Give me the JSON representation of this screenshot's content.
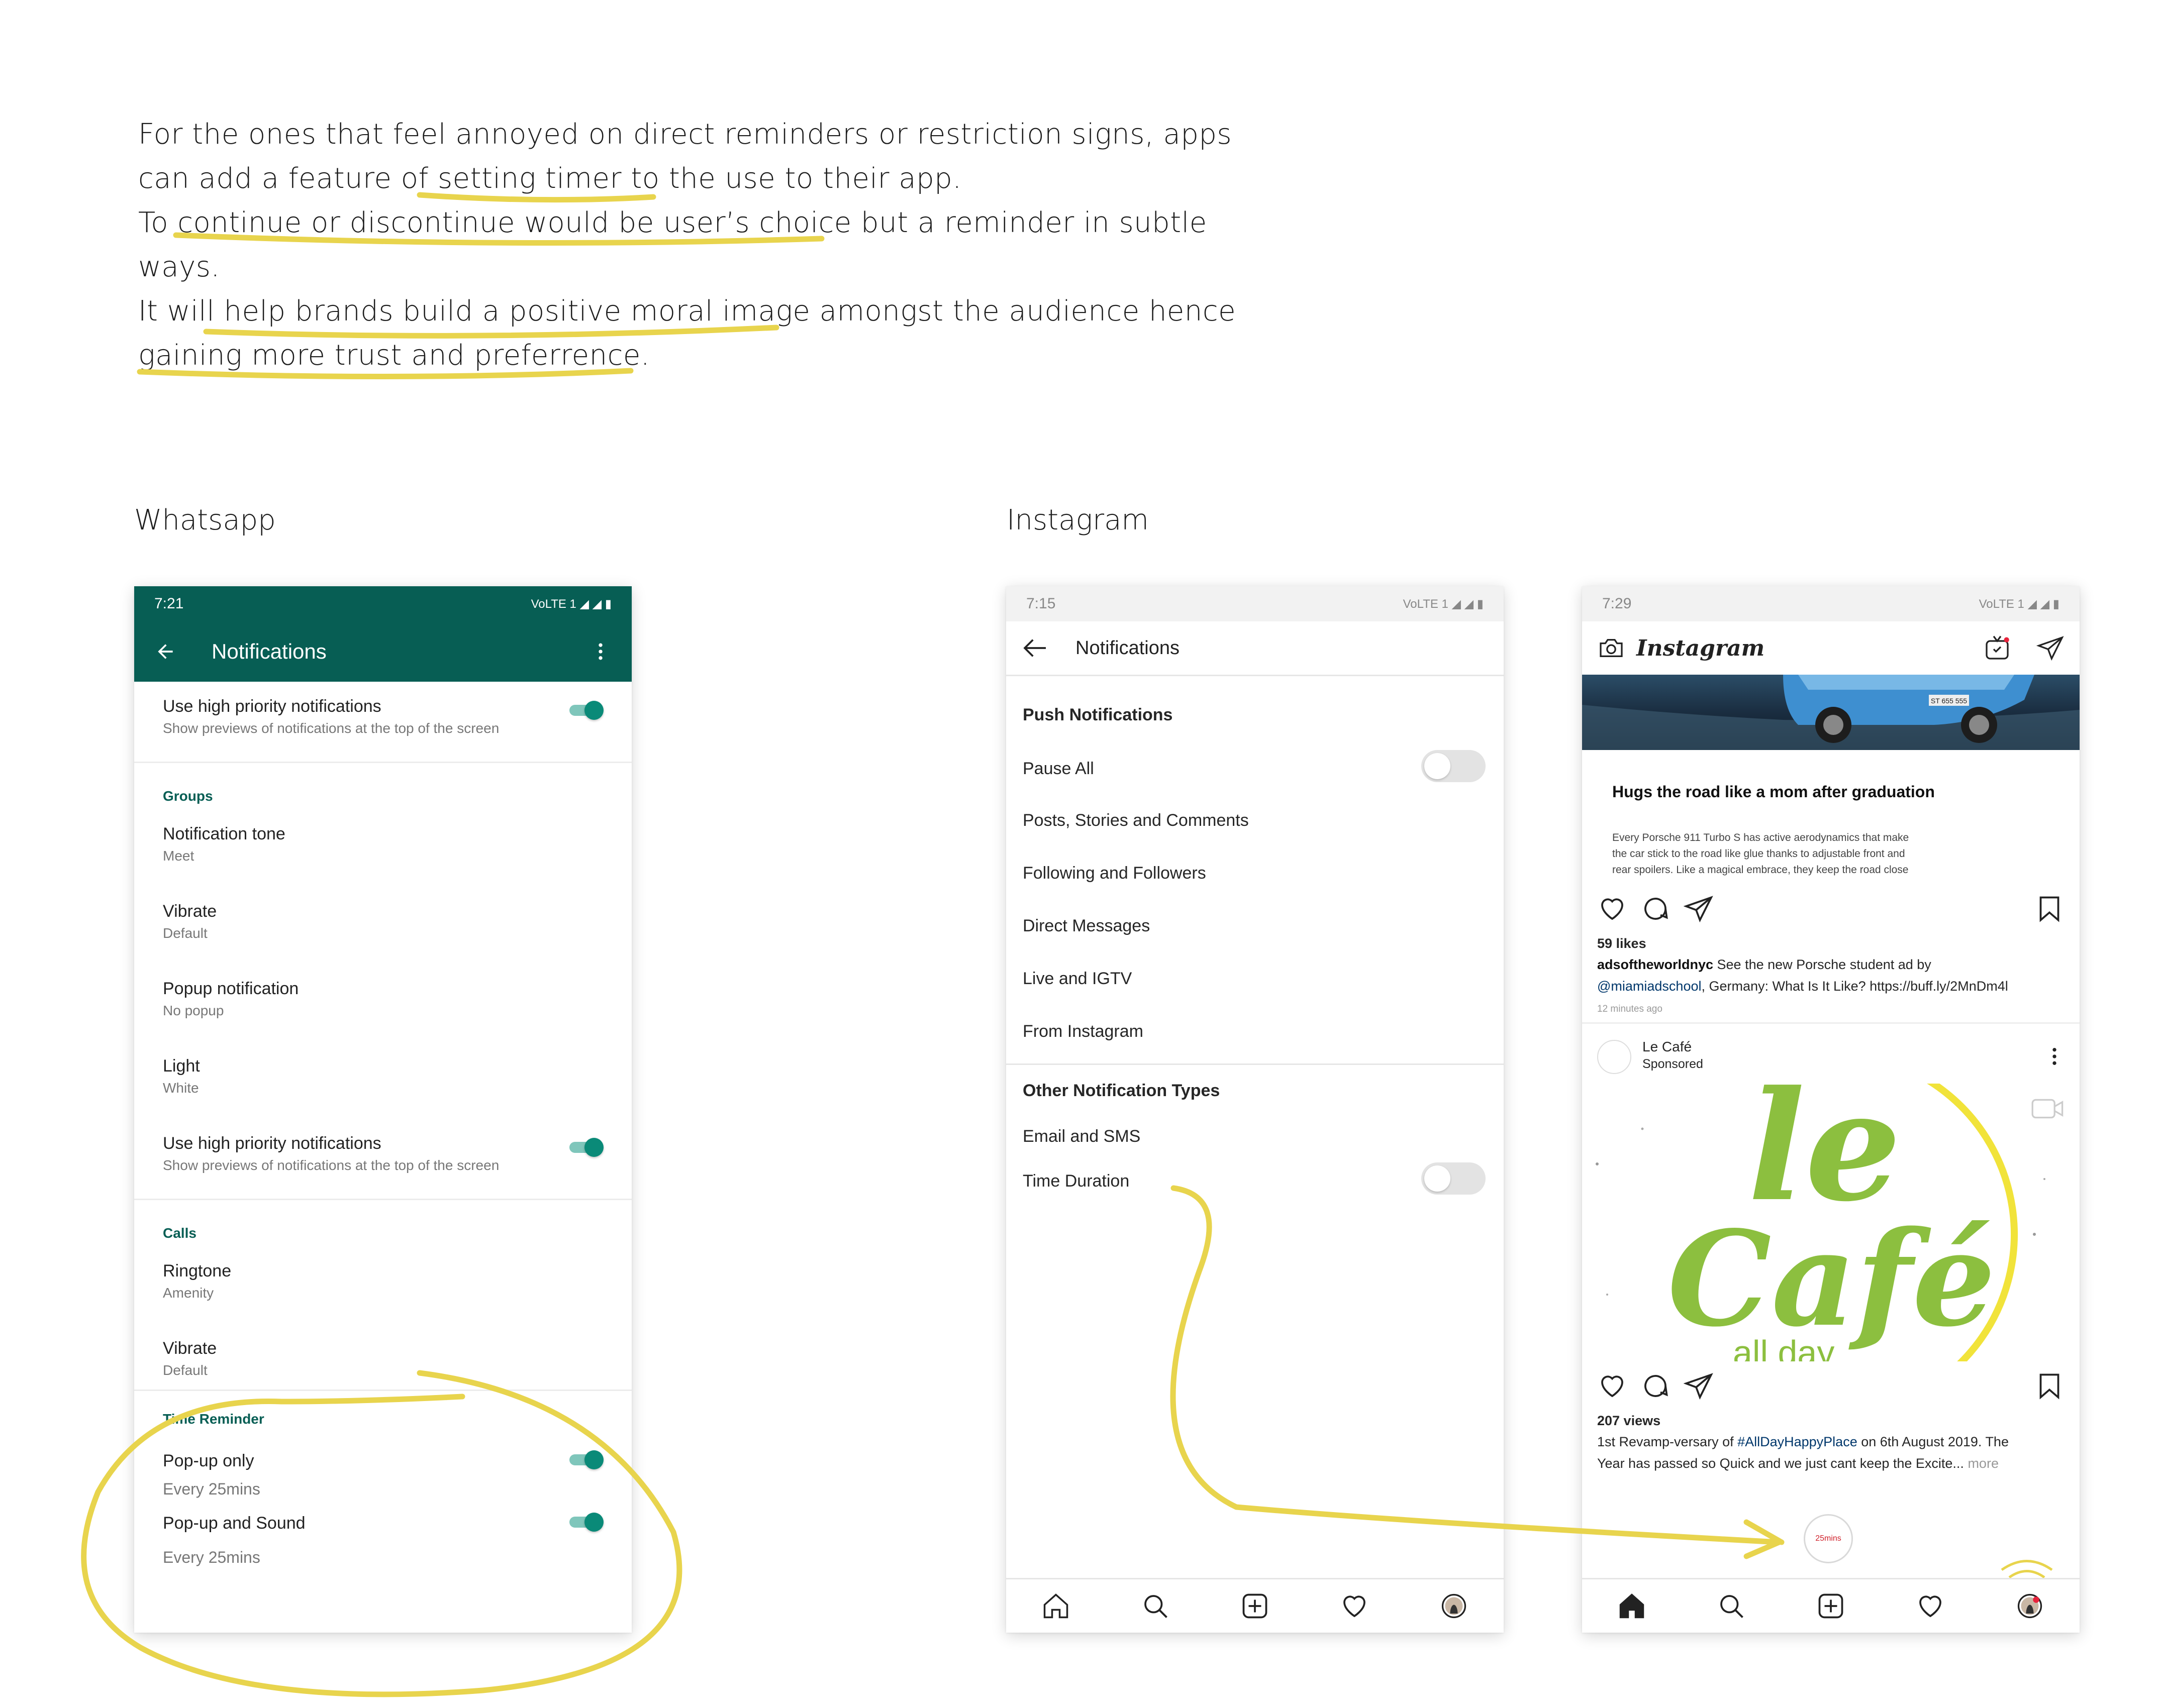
{
  "intro": {
    "lines": [
      "For the ones that feel annoyed on direct reminders or restriction signs, apps",
      "can add a feature of setting timer to the use to their app.",
      "To continue or discontinue would be user’s choice but a reminder in subtle",
      "ways.",
      "It will help brands build a positive moral image amongst the audience hence",
      "gaining more trust and preferrence."
    ]
  },
  "labels": {
    "whatsapp": "Whatsapp",
    "instagram": "Instagram"
  },
  "highlight_color": "#e8d44d",
  "whatsapp": {
    "time": "7:21",
    "status_icons": "VoLTE 1 ◢ ◢ ▮",
    "title": "Notifications",
    "rows": {
      "high_priority_1": {
        "primary": "Use high priority notifications",
        "secondary": "Show previews of notifications at the top of the screen"
      },
      "groups_header": "Groups",
      "notification_tone": {
        "primary": "Notification tone",
        "secondary": "Meet"
      },
      "vibrate_1": {
        "primary": "Vibrate",
        "secondary": "Default"
      },
      "popup": {
        "primary": "Popup notification",
        "secondary": "No popup"
      },
      "light": {
        "primary": "Light",
        "secondary": "White"
      },
      "high_priority_2": {
        "primary": "Use high priority notifications",
        "secondary": "Show previews of notifications at the top of the screen"
      },
      "calls_header": "Calls",
      "ringtone": {
        "primary": "Ringtone",
        "secondary": "Amenity"
      },
      "vibrate_2": {
        "primary": "Vibrate",
        "secondary": "Default"
      },
      "time_reminder_header": "Time Reminder",
      "popup_only": {
        "primary": "Pop-up only",
        "secondary": "Every 25mins"
      },
      "popup_sound": {
        "primary": "Pop-up and Sound",
        "secondary": "Every 25mins"
      }
    },
    "accent": "#075e54",
    "toggle_color": "#0a8a78"
  },
  "instagram_settings": {
    "time": "7:15",
    "status_icons": "VoLTE 1 ◢ ◢ ▮",
    "title": "Notifications",
    "push_header": "Push Notifications",
    "pause_all": "Pause All",
    "posts": "Posts, Stories and Comments",
    "following": "Following and Followers",
    "direct": "Direct Messages",
    "live": "Live and IGTV",
    "from_ig": "From Instagram",
    "other_header": "Other Notification Types",
    "email_sms": "Email and SMS",
    "time_duration": "Time Duration"
  },
  "instagram_feed": {
    "time": "7:29",
    "status_icons": "VoLTE 1 ◢ ◢ ▮",
    "logo": "Instagram",
    "plate": "ST 655 555",
    "post1": {
      "headline": "Hugs the road like a mom after graduation",
      "body": [
        "Every Porsche 911 Turbo S has active aerodynamics that make",
        "the car stick to the road like glue thanks to adjustable front and",
        "rear spoilers. Like a magical embrace, they keep the road close"
      ],
      "likes": "59 likes",
      "user": "adsoftheworldnyc",
      "caption_a": " See the new Porsche student ad by",
      "mention": "@miamiadschool",
      "caption_b": ", Germany: What Is It Like? https://buff.ly/2MnDm4l",
      "time_ago": "12 minutes ago"
    },
    "post2": {
      "account": "Le Café",
      "sponsored": "Sponsored",
      "logo_top": "le",
      "logo_main": "Café",
      "logo_sub": "all day",
      "views": "207 views",
      "caption_a": "1st Revamp-versary of ",
      "hashtag": "#AllDayHappyPlace",
      "caption_b": " on 6th August 2019. The",
      "caption_c": "Year has passed so Quick and we just cant keep the Excite...",
      "more": " more"
    },
    "timer_badge": "25mins",
    "cafe_green": "#8cbf3f",
    "cafe_yellow": "#f1e33a"
  }
}
